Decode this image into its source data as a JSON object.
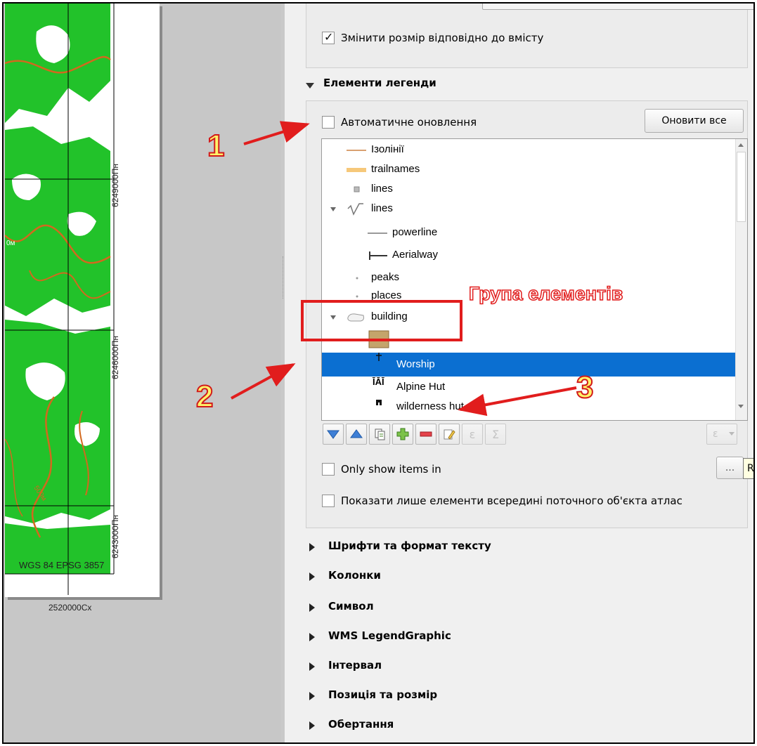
{
  "map": {
    "tick_labels_y": [
      "6249000Пн",
      "6246000Пн",
      "6243000Пн"
    ],
    "tick_label_x": "2520000Сх",
    "crs_label": "WGS 84 EPSG 3857",
    "contour_labels": [
      "0м",
      "500м"
    ],
    "colors": {
      "forest": "#22c22a",
      "contour": "#d2691e",
      "grid": "#000000"
    }
  },
  "panel": {
    "resize_checkbox": {
      "label": "Змінити розмір відповідно до вмісту",
      "checked": true
    },
    "legend_items_section": {
      "title": "Елементи легенди",
      "auto_update": {
        "label": "Автоматичне оновлення",
        "checked": false
      },
      "update_all_button": "Оновити все",
      "tree": [
        {
          "label": "Ізолінії",
          "symbol": "line-orange"
        },
        {
          "label": "trailnames",
          "symbol": "line-thick-yellow"
        },
        {
          "label": "lines",
          "symbol": "point-square"
        },
        {
          "label": "lines",
          "symbol": "graph-icon",
          "expanded": true
        },
        {
          "label": "powerline",
          "symbol": "line-gray"
        },
        {
          "label": "Aerialway",
          "symbol": "line-aerialway"
        },
        {
          "label": "peaks",
          "symbol": "dot"
        },
        {
          "label": "places",
          "symbol": "dot"
        },
        {
          "label": "building",
          "symbol": "polygon-icon",
          "expanded": true
        },
        {
          "label": "",
          "symbol": "fill-tan"
        },
        {
          "label": "Worship",
          "symbol": "cross",
          "selected": true
        },
        {
          "label": "Alpine Hut",
          "symbol": "hut-icon"
        },
        {
          "label": "wilderness hut",
          "symbol": "square-black"
        }
      ],
      "toolbar": {
        "move_down": "move-down-icon",
        "move_up": "move-up-icon",
        "add_group": "add-group-icon",
        "add_item": "add-icon",
        "remove_item": "remove-icon",
        "edit_item": "edit-icon",
        "expression": "ε",
        "sum": "Σ",
        "expression_filter": "ε"
      },
      "tooltip": "Remove selected item(s) from legend",
      "only_show_items": {
        "label": "Only show items in",
        "checked": false
      },
      "more_button": "...",
      "atlas_filter": {
        "label": "Показати лише елементи всередині поточного об'єкта атлас",
        "checked": false
      }
    },
    "collapsed_sections": [
      "Шрифти та формат тексту",
      "Колонки",
      "Символ",
      "WMS LegendGraphic",
      "Інтервал",
      "Позиція та розмір",
      "Обертання"
    ]
  },
  "annotations": {
    "numbers": [
      "1",
      "2",
      "3"
    ],
    "group_label": "Група елементів",
    "color": "#e11d1d"
  }
}
